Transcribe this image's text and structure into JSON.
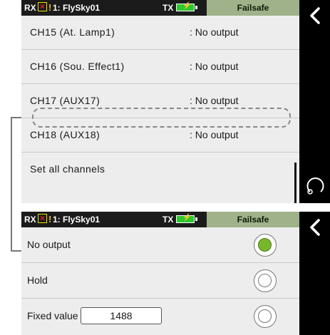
{
  "colors": {
    "status_bar_bg": "#1b1b1b",
    "title_bg": "#9fb28a",
    "panel_bg": "#ededed",
    "radio_selected": "#76b82a",
    "battery": "#2ec72e",
    "warning": "#f2c200",
    "rx_error": "#e02020"
  },
  "status_bar": {
    "rx_label": "RX",
    "rx_error_icon": "x-box-icon",
    "warning_icon": "exclamation-icon",
    "model_name": "1: FlySky01",
    "tx_label": "TX",
    "battery_icon": "battery-charging-icon",
    "battery_symbol": "⚡",
    "title": "Failsafe"
  },
  "top_screen": {
    "channels": [
      {
        "label": "CH15  (At. Lamp1)",
        "value": ": No  output"
      },
      {
        "label": "CH16  (Sou. Effect1)",
        "value": ": No  output"
      },
      {
        "label": "CH17  (AUX17)",
        "value": ": No  output"
      },
      {
        "label": "CH18  (AUX18)",
        "value": ": No  output"
      }
    ],
    "set_all_label": "Set  all  channels",
    "sidebar": {
      "back_icon": "chevron-left-icon",
      "back_symbol": "❮",
      "rotate_icon": "rotate-icon"
    }
  },
  "bottom_screen": {
    "options": [
      {
        "label": "No output",
        "selected": true
      },
      {
        "label": "Hold",
        "selected": false
      },
      {
        "label": "Fixed  value",
        "selected": false,
        "value": "1488"
      }
    ],
    "sidebar": {
      "back_icon": "chevron-left-icon",
      "back_symbol": "❮"
    }
  }
}
